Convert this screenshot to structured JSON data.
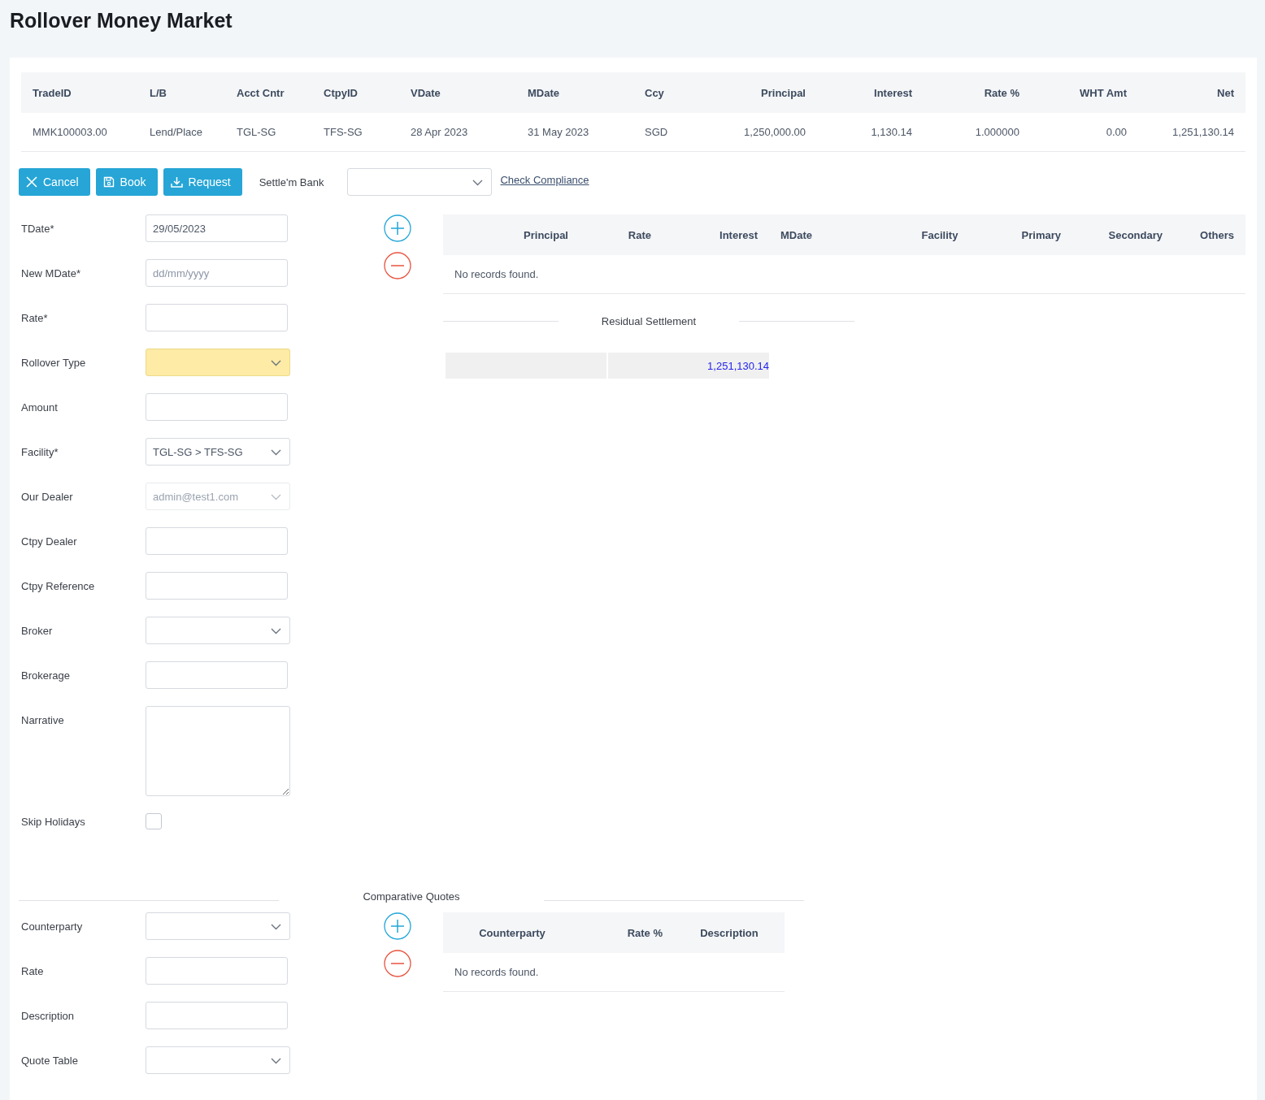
{
  "page": {
    "title": "Rollover Money Market"
  },
  "trade_table": {
    "columns": [
      "TradeID",
      "L/B",
      "Acct Cntr",
      "CtpyID",
      "VDate",
      "MDate",
      "Ccy",
      "Principal",
      "Interest",
      "Rate %",
      "WHT Amt",
      "Net"
    ],
    "rows": [
      [
        "MMK100003.00",
        "Lend/Place",
        "TGL-SG",
        "TFS-SG",
        "28 Apr 2023",
        "31 May 2023",
        "SGD",
        "1,250,000.00",
        "1,130.14",
        "1.000000",
        "0.00",
        "1,251,130.14"
      ]
    ]
  },
  "toolbar": {
    "buttons": [
      "Cancel",
      "Book",
      "Request"
    ],
    "settle_bank": {
      "label": "Settle'm Bank"
    },
    "link": "Check Compliance"
  },
  "form": [
    {
      "kind": "input",
      "label": "TDate*",
      "value": "29/05/2023"
    },
    {
      "kind": "input",
      "label": "New MDate*",
      "placeholder": "dd/mm/yyyy"
    },
    {
      "kind": "input",
      "label": "Rate*"
    },
    {
      "kind": "select",
      "label": "Rollover Type",
      "highlighted": true,
      "disabled": false
    },
    {
      "kind": "input",
      "label": "Amount"
    },
    {
      "kind": "select",
      "label": "Facility*",
      "value": "TGL-SG > TFS-SG",
      "highlighted": false,
      "disabled": false
    },
    {
      "kind": "select",
      "label": "Our Dealer",
      "value": "admin@test1.com",
      "highlighted": false,
      "disabled": true
    },
    {
      "kind": "input",
      "label": "Ctpy Dealer"
    },
    {
      "kind": "input",
      "label": "Ctpy Reference"
    },
    {
      "kind": "select",
      "label": "Broker",
      "highlighted": false,
      "disabled": false
    },
    {
      "kind": "input",
      "label": "Brokerage"
    },
    {
      "kind": "textarea",
      "label": "Narrative"
    },
    {
      "kind": "checkbox",
      "label": "Skip Holidays",
      "checked": false
    }
  ],
  "legs_table": {
    "columns": [
      "Principal",
      "Rate",
      "Interest",
      "MDate",
      "Facility",
      "Primary",
      "Secondary",
      "Others"
    ],
    "empty_message": "No records found."
  },
  "residual": {
    "title": "Residual Settlement",
    "value": "1,251,130.14"
  },
  "quotes": {
    "title": "Comparative Quotes",
    "form": [
      {
        "kind": "select",
        "label": "Counterparty"
      },
      {
        "kind": "input",
        "label": "Rate"
      },
      {
        "kind": "input",
        "label": "Description"
      },
      {
        "kind": "select",
        "label": "Quote Table"
      }
    ],
    "table": {
      "columns": [
        "Counterparty",
        "Rate %",
        "Description"
      ],
      "empty_message": "No records found."
    }
  }
}
